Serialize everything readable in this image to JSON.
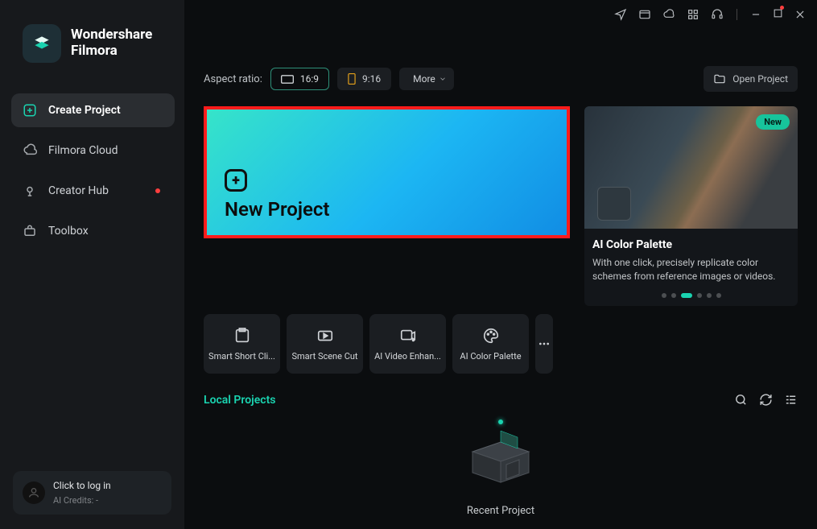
{
  "brand": {
    "line1": "Wondershare",
    "line2": "Filmora"
  },
  "sidebar": {
    "items": [
      {
        "label": "Create Project"
      },
      {
        "label": "Filmora Cloud"
      },
      {
        "label": "Creator Hub"
      },
      {
        "label": "Toolbox"
      }
    ]
  },
  "login": {
    "prompt": "Click to log in",
    "credits": "AI Credits: -"
  },
  "aspect": {
    "label": "Aspect ratio:",
    "opt_16_9": "16:9",
    "opt_9_16": "9:16",
    "more": "More"
  },
  "open_project": "Open Project",
  "new_project": {
    "title": "New Project"
  },
  "feature": {
    "badge": "New",
    "title": "AI Color Palette",
    "desc": "With one click, precisely replicate color schemes from reference images or videos."
  },
  "tiles": [
    {
      "label": "Smart Short Cli..."
    },
    {
      "label": "Smart Scene Cut"
    },
    {
      "label": "AI Video Enhan..."
    },
    {
      "label": "AI Color Palette"
    }
  ],
  "local_projects_label": "Local Projects",
  "recent_project_label": "Recent Project"
}
